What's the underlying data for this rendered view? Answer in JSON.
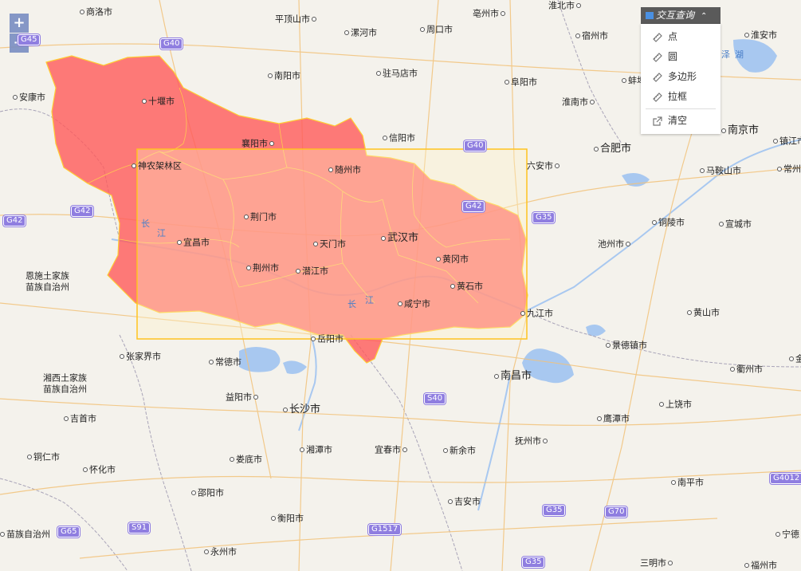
{
  "zoom": {
    "in_label": "+",
    "out_label": "−"
  },
  "query_panel": {
    "title": "交互查询",
    "items": [
      {
        "label": "点",
        "icon": "ruler-icon"
      },
      {
        "label": "圆",
        "icon": "ruler-icon"
      },
      {
        "label": "多边形",
        "icon": "ruler-icon"
      },
      {
        "label": "拉框",
        "icon": "ruler-icon"
      }
    ],
    "clear_label": "清空",
    "clear_icon": "export-icon"
  },
  "colors": {
    "province_fill": "#ff5a5a",
    "province_border": "#ffcc33",
    "selection_box": "#ffc31f",
    "panel_header": "#5a5a5a",
    "zoom_button": "#7a8ec2",
    "water": "#a8c8f0"
  },
  "cities": [
    {
      "name": "商洛市"
    },
    {
      "name": "平顶山市"
    },
    {
      "name": "漯河市"
    },
    {
      "name": "周口市"
    },
    {
      "name": "亳州市"
    },
    {
      "name": "淮北市"
    },
    {
      "name": "宿州市"
    },
    {
      "name": "淮安市"
    },
    {
      "name": "安康市"
    },
    {
      "name": "十堰市"
    },
    {
      "name": "南阳市"
    },
    {
      "name": "驻马店市"
    },
    {
      "name": "阜阳市"
    },
    {
      "name": "淮南市"
    },
    {
      "name": "蚌埠"
    },
    {
      "name": "信阳市"
    },
    {
      "name": "襄阳市"
    },
    {
      "name": "合肥市"
    },
    {
      "name": "南京市"
    },
    {
      "name": "镇江市"
    },
    {
      "name": "神农架林区"
    },
    {
      "name": "随州市"
    },
    {
      "name": "六安市"
    },
    {
      "name": "马鞍山市"
    },
    {
      "name": "常州市"
    },
    {
      "name": "荆门市"
    },
    {
      "name": "铜陵市"
    },
    {
      "name": "宣城市"
    },
    {
      "name": "宜昌市"
    },
    {
      "name": "武汉市"
    },
    {
      "name": "天门市"
    },
    {
      "name": "池州市"
    },
    {
      "name": "黄冈市"
    },
    {
      "name": "恩施土家族苗族自治州"
    },
    {
      "name": "荆州市"
    },
    {
      "name": "潜江市"
    },
    {
      "name": "黄石市"
    },
    {
      "name": "咸宁市"
    },
    {
      "name": "九江市"
    },
    {
      "name": "黄山市"
    },
    {
      "name": "岳阳市"
    },
    {
      "name": "景德镇市"
    },
    {
      "name": "张家界市"
    },
    {
      "name": "常德市"
    },
    {
      "name": "南昌市"
    },
    {
      "name": "衢州市"
    },
    {
      "name": "金"
    },
    {
      "name": "湘西土家族苗族自治州"
    },
    {
      "name": "益阳市"
    },
    {
      "name": "长沙市"
    },
    {
      "name": "上饶市"
    },
    {
      "name": "吉首市"
    },
    {
      "name": "鹰潭市"
    },
    {
      "name": "抚州市"
    },
    {
      "name": "湘潭市"
    },
    {
      "name": "宜春市"
    },
    {
      "name": "新余市"
    },
    {
      "name": "铜仁市"
    },
    {
      "name": "怀化市"
    },
    {
      "name": "娄底市"
    },
    {
      "name": "南平市"
    },
    {
      "name": "邵阳市"
    },
    {
      "name": "吉安市"
    },
    {
      "name": "衡阳市"
    },
    {
      "name": "宁德"
    },
    {
      "name": "苗族自治州"
    },
    {
      "name": "永州市"
    },
    {
      "name": "三明市"
    },
    {
      "name": "福州市"
    }
  ],
  "water_labels": [
    "长",
    "江",
    "长",
    "江",
    "泽",
    "湖"
  ],
  "highways": [
    "G45",
    "G40",
    "G40",
    "G42",
    "G42",
    "G42",
    "G35",
    "S40",
    "G4012",
    "G35",
    "G70",
    "G65",
    "S91",
    "G1517",
    "G35"
  ]
}
